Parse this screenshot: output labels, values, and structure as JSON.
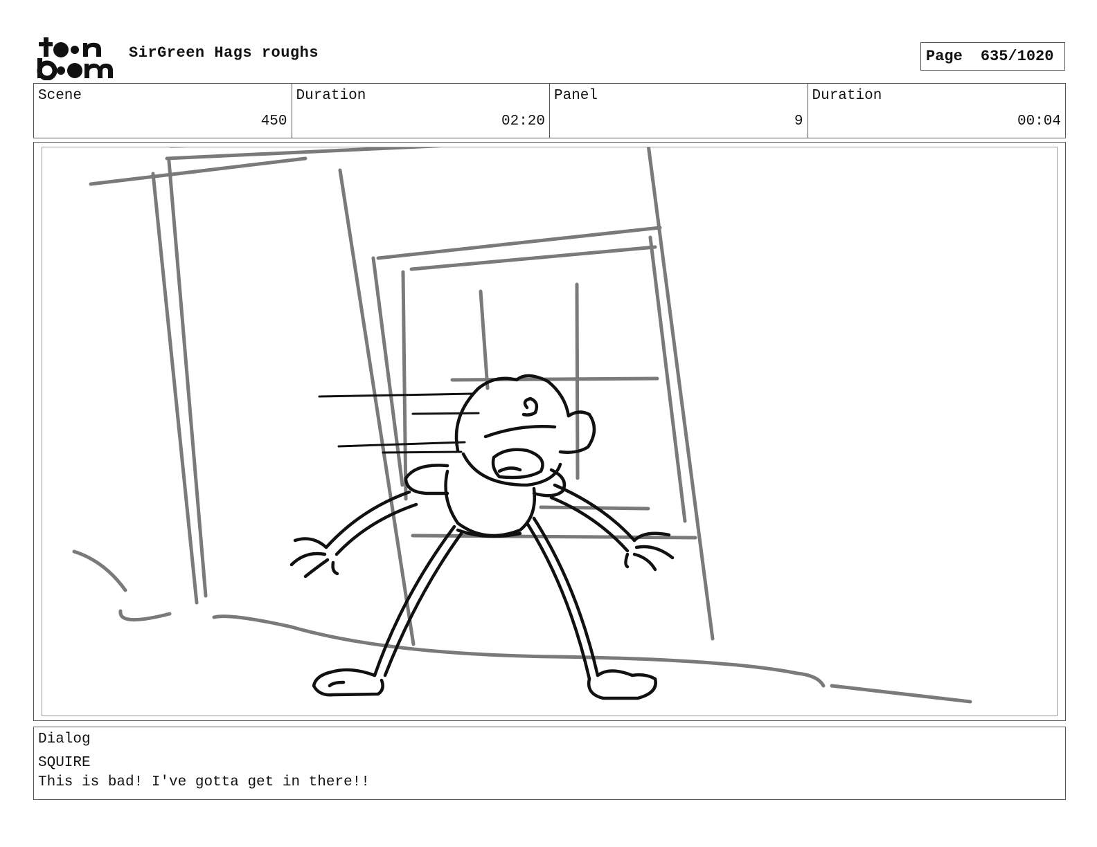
{
  "header": {
    "project_title": "SirGreen Hags roughs",
    "page_label": "Page",
    "page_value": "635/1020"
  },
  "info": {
    "scene_label": "Scene",
    "scene_value": "450",
    "scene_duration_label": "Duration",
    "scene_duration_value": "02:20",
    "panel_label": "Panel",
    "panel_value": "9",
    "panel_duration_label": "Duration",
    "panel_duration_value": "00:04"
  },
  "dialog": {
    "label": "Dialog",
    "speaker": "SQUIRE",
    "line": "This is bad! I've gotta get in there!!"
  },
  "logo": {
    "icon": "toonboom-logo"
  }
}
